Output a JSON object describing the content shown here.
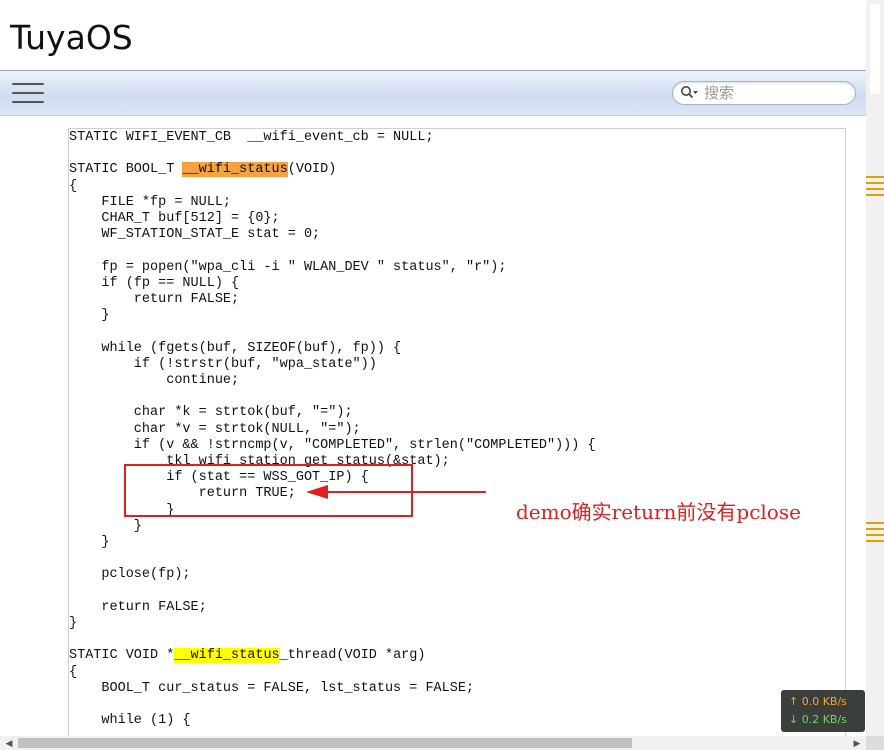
{
  "site": {
    "title": "TuyaOS"
  },
  "toolbar": {
    "menu_icon": "hamburger-menu-icon",
    "search": {
      "placeholder": "搜索",
      "value": "",
      "icon": "search-icon"
    }
  },
  "code": {
    "lines": [
      [
        "STATIC WIFI_EVENT_CB  __wifi_event_cb = NULL;"
      ],
      [
        ""
      ],
      [
        "STATIC BOOL_T ",
        "__wifi_status",
        "(VOID)"
      ],
      [
        "{"
      ],
      [
        "    FILE *fp = NULL;"
      ],
      [
        "    CHAR_T buf[512] = {0};"
      ],
      [
        "    WF_STATION_STAT_E stat = 0;"
      ],
      [
        ""
      ],
      [
        "    fp = popen(\"wpa_cli -i \" WLAN_DEV \" status\", \"r\");"
      ],
      [
        "    if (fp == NULL) {"
      ],
      [
        "        return FALSE;"
      ],
      [
        "    }"
      ],
      [
        ""
      ],
      [
        "    while (fgets(buf, SIZEOF(buf), fp)) {"
      ],
      [
        "        if (!strstr(buf, \"wpa_state\"))"
      ],
      [
        "            continue;"
      ],
      [
        ""
      ],
      [
        "        char *k = strtok(buf, \"=\");"
      ],
      [
        "        char *v = strtok(NULL, \"=\");"
      ],
      [
        "        if (v && !strncmp(v, \"COMPLETED\", strlen(\"COMPLETED\"))) {"
      ],
      [
        "            tkl_wifi_station_get_status(&stat);"
      ],
      [
        "            if (stat == WSS_GOT_IP) {"
      ],
      [
        "                return TRUE;"
      ],
      [
        "            }"
      ],
      [
        "        }"
      ],
      [
        "    }"
      ],
      [
        ""
      ],
      [
        "    pclose(fp);"
      ],
      [
        ""
      ],
      [
        "    return FALSE;"
      ],
      [
        "}"
      ],
      [
        ""
      ],
      [
        "STATIC VOID *",
        "__wifi_status",
        "_thread(VOID *arg)"
      ],
      [
        "{"
      ],
      [
        "    BOOL_T cur_status = FALSE, lst_status = FALSE;"
      ],
      [
        ""
      ],
      [
        "    while (1) {"
      ]
    ],
    "highlights": [
      {
        "line": 2,
        "segment": 1,
        "color": "#f5a340"
      },
      {
        "line": 32,
        "segment": 1,
        "color": "#ffff00"
      }
    ]
  },
  "annotation": {
    "text": "demo确实return前没有pclose",
    "color": "#e02020"
  },
  "net_monitor": {
    "upload": "0.0 KB/s",
    "download": "0.2 KB/s",
    "upload_arrow": "↑",
    "download_arrow": "↓"
  }
}
